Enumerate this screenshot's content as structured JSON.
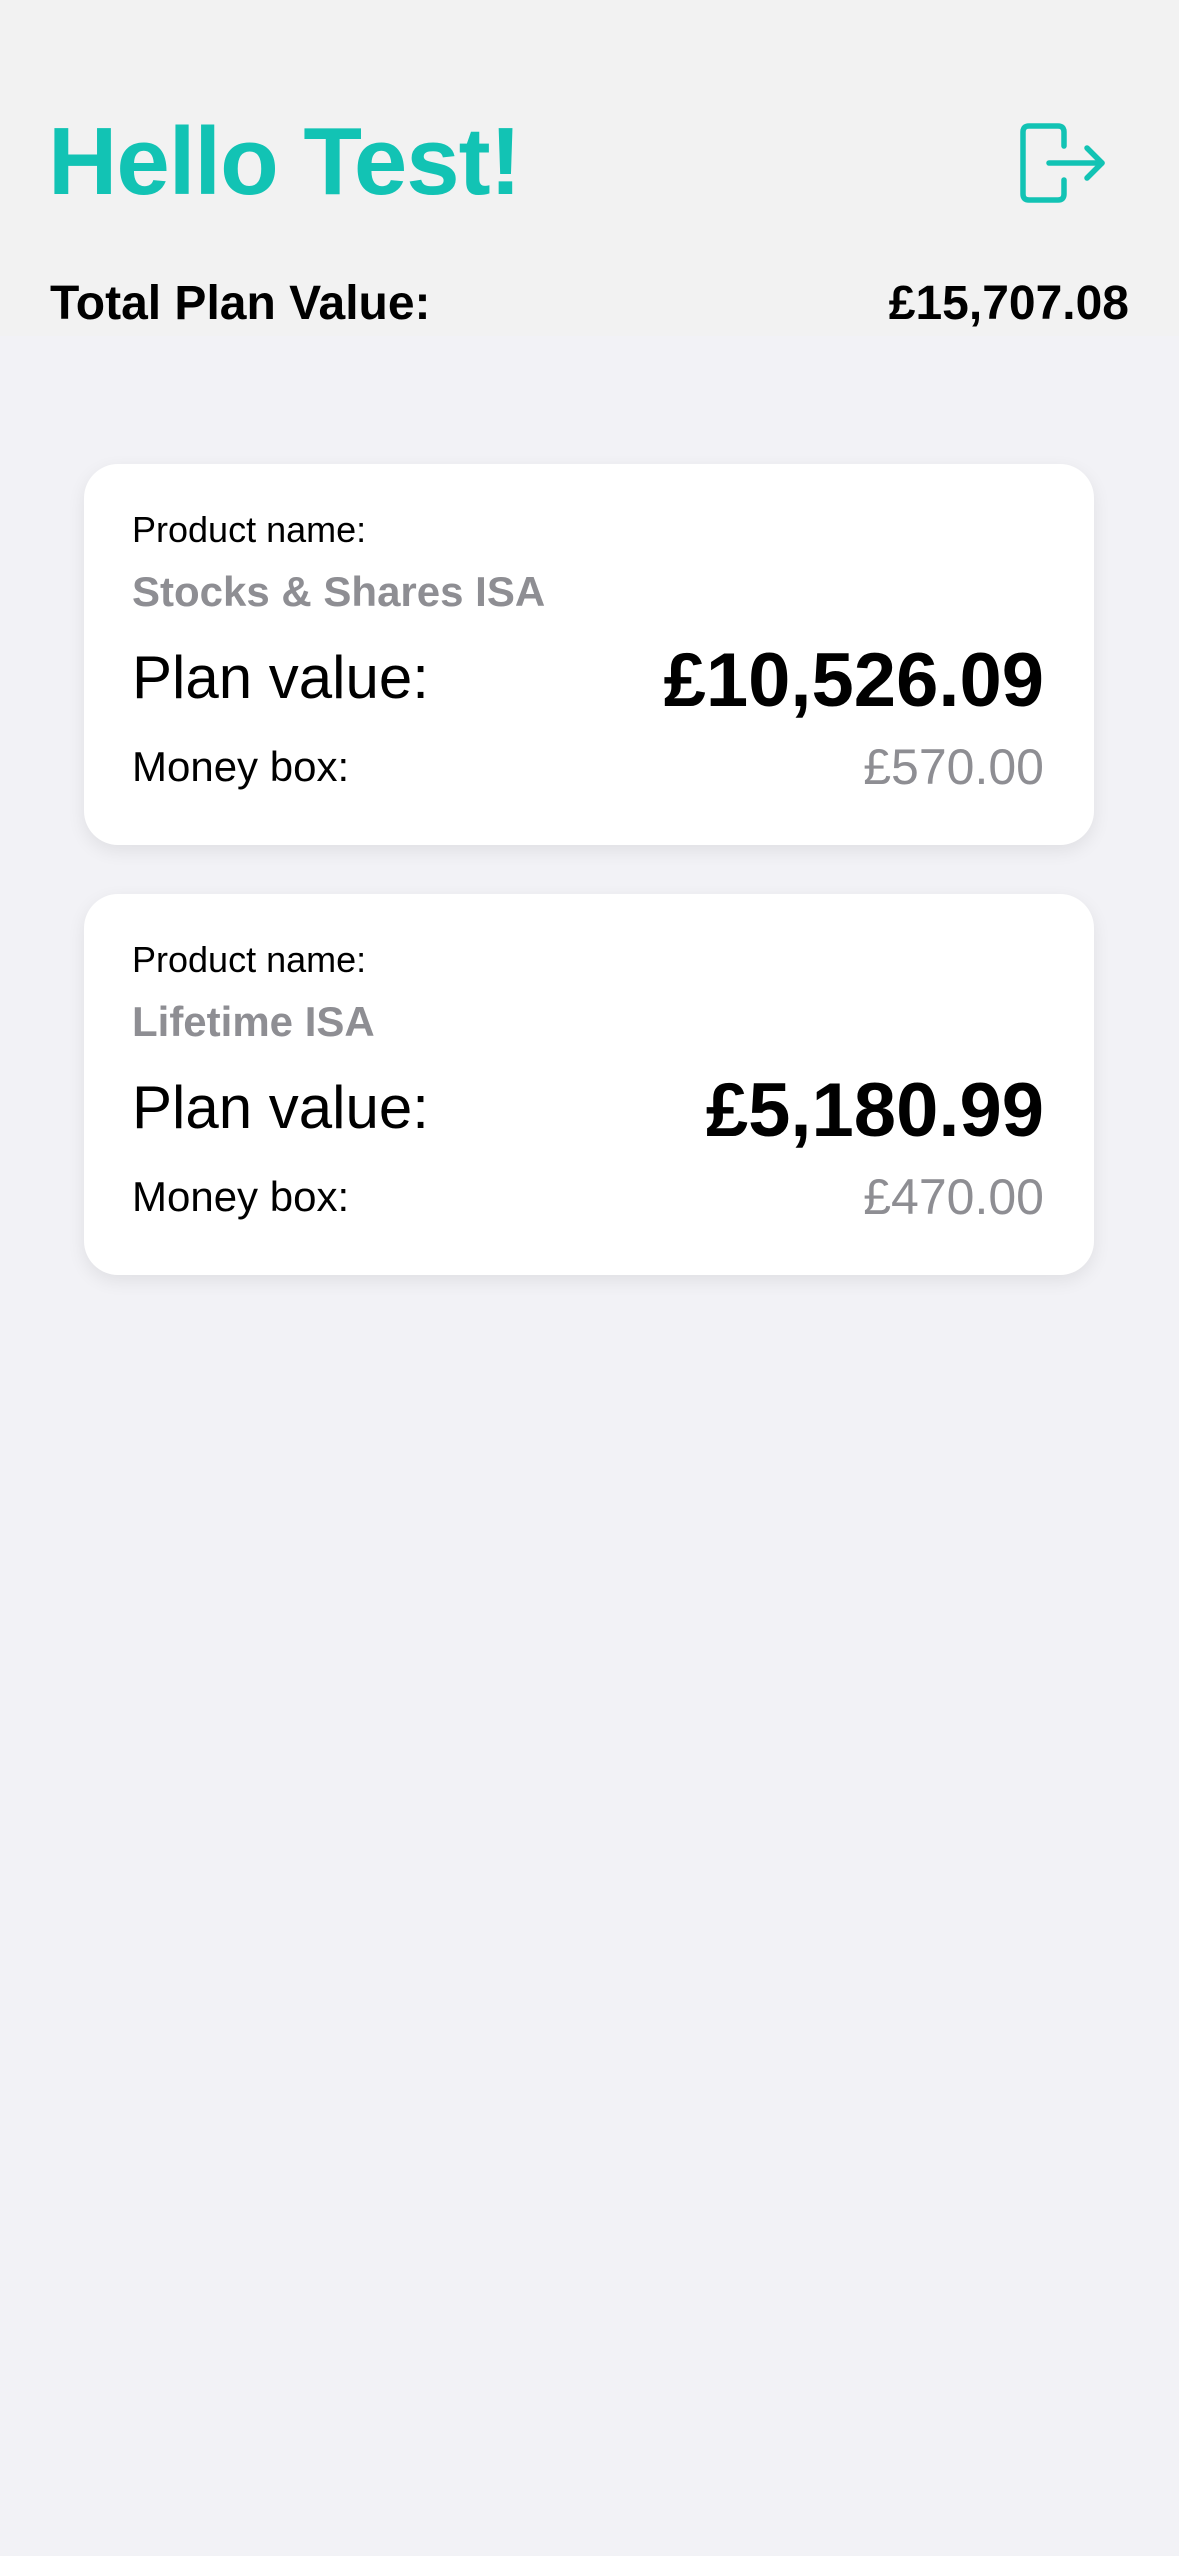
{
  "header": {
    "greeting": "Hello Test!",
    "logout_icon": "logout-icon",
    "total_label": "Total Plan Value:",
    "total_value": "£15,707.08"
  },
  "plans": [
    {
      "product_label": "Product name:",
      "product_name": "Stocks & Shares ISA",
      "plan_label": "Plan value:",
      "plan_value": "£10,526.09",
      "money_box_label": "Money box:",
      "money_box_value": "£570.00"
    },
    {
      "product_label": "Product name:",
      "product_name": "Lifetime ISA",
      "plan_label": "Plan value:",
      "plan_value": "£5,180.99",
      "money_box_label": "Money box:",
      "money_box_value": "£470.00"
    }
  ],
  "colors": {
    "accent": "#12c3b4",
    "background": "#f2f2f6",
    "secondary_text": "#8e8e93"
  }
}
